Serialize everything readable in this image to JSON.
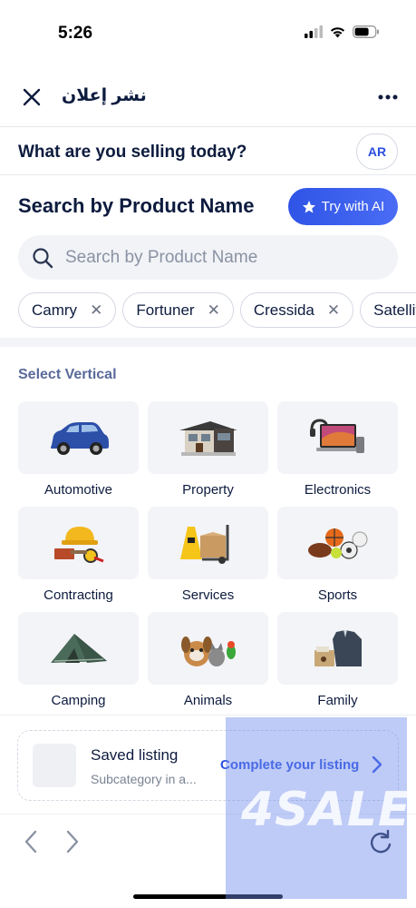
{
  "status_bar": {
    "time": "5:26"
  },
  "header": {
    "title": "نشر إعلان"
  },
  "question": {
    "text": "What are you selling today?",
    "lang_button": "AR"
  },
  "search": {
    "heading": "Search by Product Name",
    "ai_button": "Try with AI",
    "placeholder": "Search by Product Name"
  },
  "chips": [
    "Camry",
    "Fortuner",
    "Cressida",
    "Satellite"
  ],
  "verticals": {
    "title": "Select Vertical",
    "items": [
      {
        "label": "Automotive",
        "icon": "car-icon"
      },
      {
        "label": "Property",
        "icon": "house-icon"
      },
      {
        "label": "Electronics",
        "icon": "laptop-icon"
      },
      {
        "label": "Contracting",
        "icon": "hardhat-icon"
      },
      {
        "label": "Services",
        "icon": "dolly-icon"
      },
      {
        "label": "Sports",
        "icon": "balls-icon"
      },
      {
        "label": "Camping",
        "icon": "tent-icon"
      },
      {
        "label": "Animals",
        "icon": "pets-icon"
      },
      {
        "label": "Family",
        "icon": "clothes-icon"
      }
    ]
  },
  "saved": {
    "title": "Saved listing",
    "subtitle": "Subcategory in a...",
    "link": "Complete your listing"
  },
  "watermark": "4SALE",
  "colors": {
    "accent": "#2b4fe0",
    "text": "#0d1b3e",
    "tile_bg": "#f3f4f7"
  }
}
